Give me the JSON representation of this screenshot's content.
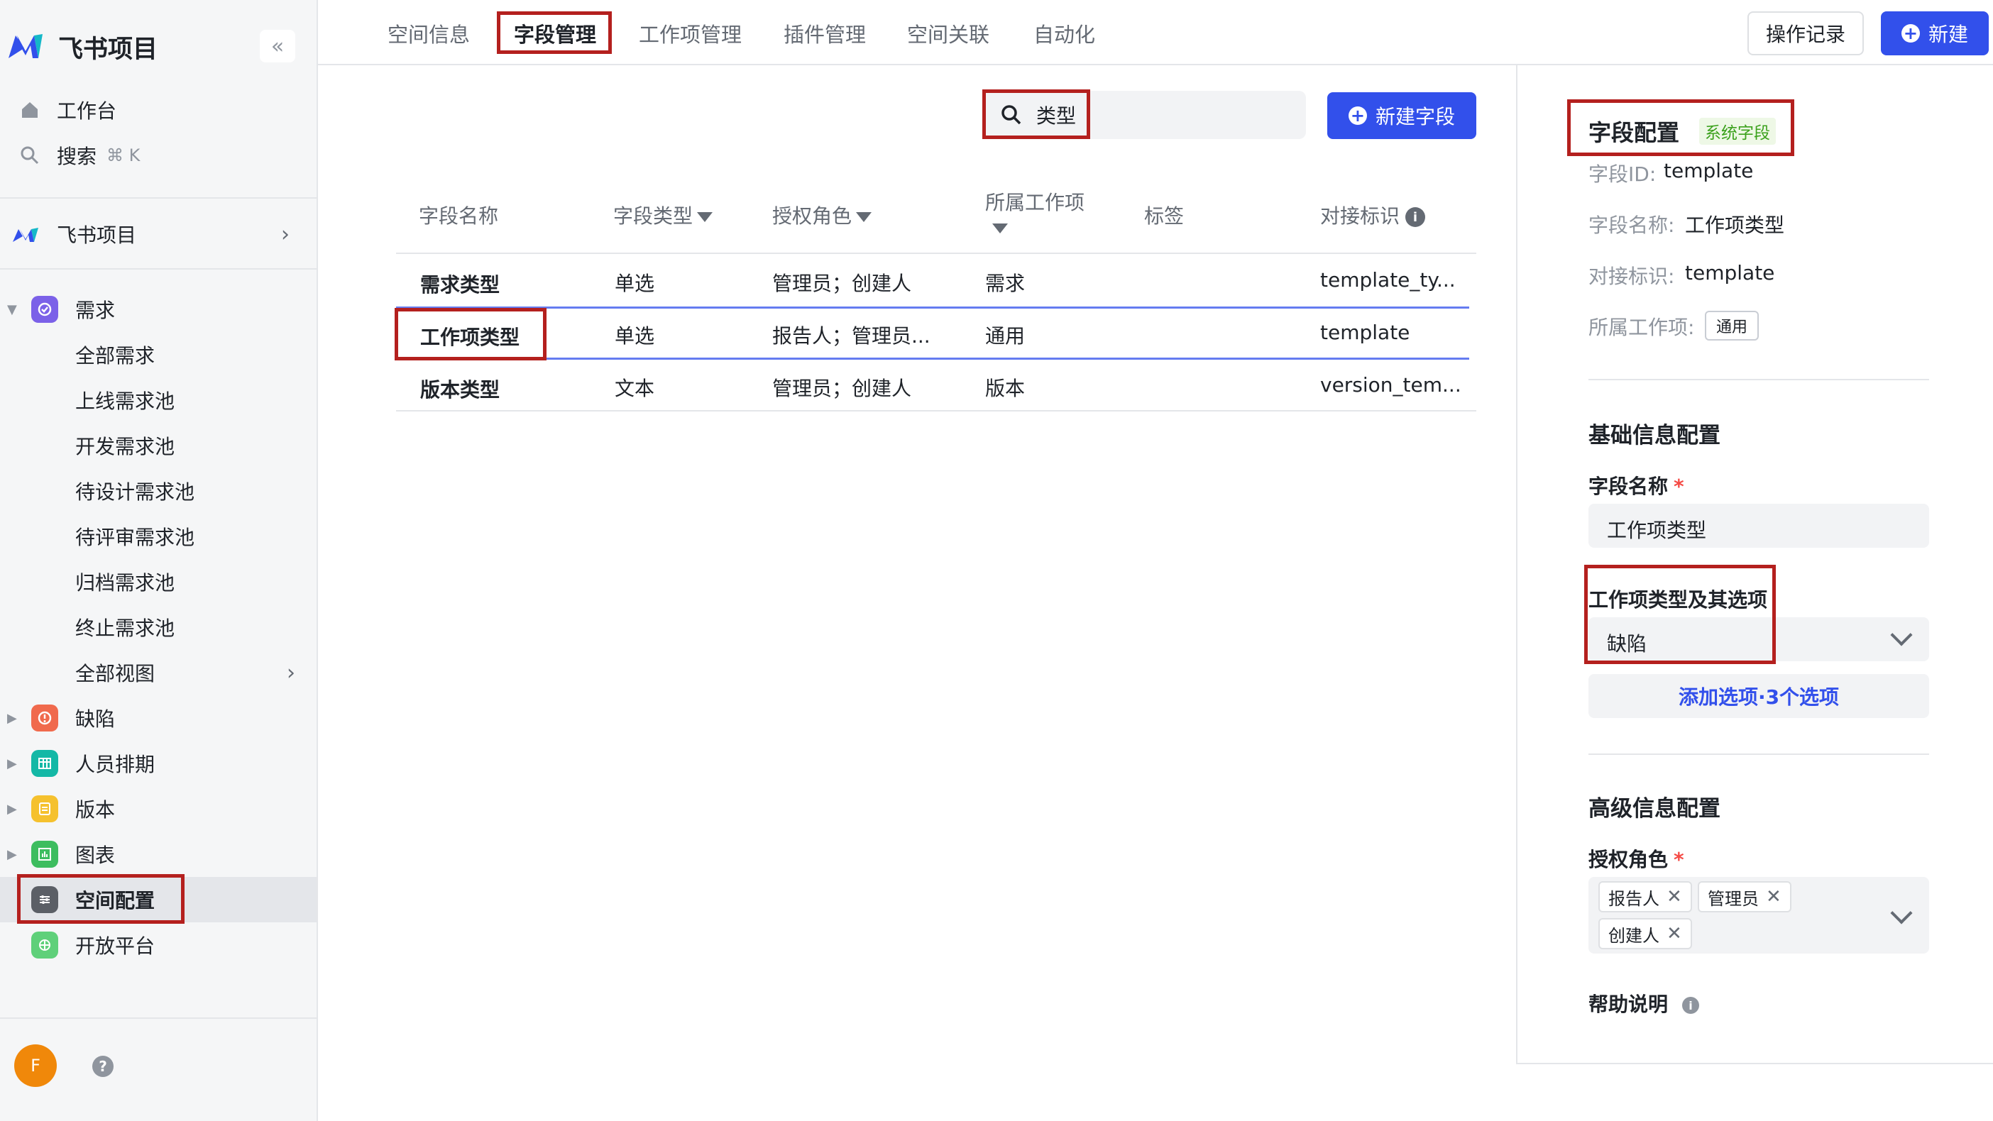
{
  "app": {
    "brand_name": "飞书项目",
    "collapse_label": "«"
  },
  "sidebar": {
    "workbench": "工作台",
    "search": "搜索",
    "search_shortcut": "⌘ K",
    "project": "飞书项目",
    "categories": [
      {
        "label": "需求",
        "icon": "check-circle-icon",
        "color": "#7b61e8",
        "expanded": true
      },
      {
        "label": "缺陷",
        "icon": "alert-circle-icon",
        "color": "#f06a4d",
        "expanded": false
      },
      {
        "label": "人员排期",
        "icon": "calendar-grid-icon",
        "color": "#14b8a6",
        "expanded": false
      },
      {
        "label": "版本",
        "icon": "version-icon",
        "color": "#f5c12e",
        "expanded": false
      },
      {
        "label": "图表",
        "icon": "bar-chart-icon",
        "color": "#3dbd5f",
        "expanded": false
      }
    ],
    "requirement_views": [
      "全部需求",
      "上线需求池",
      "开发需求池",
      "待设计需求池",
      "待评审需求池",
      "归档需求池",
      "终止需求池",
      "全部视图"
    ],
    "space_config": "空间配置",
    "open_platform": "开放平台",
    "avatar_letter": "F",
    "help": "?"
  },
  "topbar": {
    "tabs": [
      "空间信息",
      "字段管理",
      "工作项管理",
      "插件管理",
      "空间关联",
      "自动化"
    ],
    "active_tab": "字段管理",
    "log_button": "操作记录",
    "new_button": "新建"
  },
  "main": {
    "search_value": "类型",
    "new_field_button": "新建字段",
    "columns": [
      "字段名称",
      "字段类型",
      "授权角色",
      "所属工作项",
      "标签",
      "对接标识"
    ],
    "rows": [
      {
        "name": "需求类型",
        "type": "单选",
        "roles": "管理员；创建人",
        "workitem": "需求",
        "tag": "",
        "key": "template_ty..."
      },
      {
        "name": "工作项类型",
        "type": "单选",
        "roles": "报告人；管理员...",
        "workitem": "通用",
        "tag": "",
        "key": "template"
      },
      {
        "name": "版本类型",
        "type": "文本",
        "roles": "管理员；创建人",
        "workitem": "版本",
        "tag": "",
        "key": "version_tem..."
      }
    ],
    "selected_row": 1
  },
  "panel": {
    "title": "字段配置",
    "badge": "系统字段",
    "field_id_label": "字段ID:",
    "field_id": "template",
    "field_name_label": "字段名称:",
    "field_name": "工作项类型",
    "key_label": "对接标识:",
    "key": "template",
    "workitem_label": "所属工作项:",
    "workitem": "通用",
    "basic_section": "基础信息配置",
    "name_input_label": "字段名称",
    "name_input_value": "工作项类型",
    "options_label": "工作项类型及其选项",
    "options_selected": "缺陷",
    "add_option": "添加选项·3个选项",
    "advanced_section": "高级信息配置",
    "roles_label": "授权角色",
    "roles": [
      "报告人",
      "管理员",
      "创建人"
    ],
    "help_label": "帮助说明",
    "required_mark": "*"
  }
}
